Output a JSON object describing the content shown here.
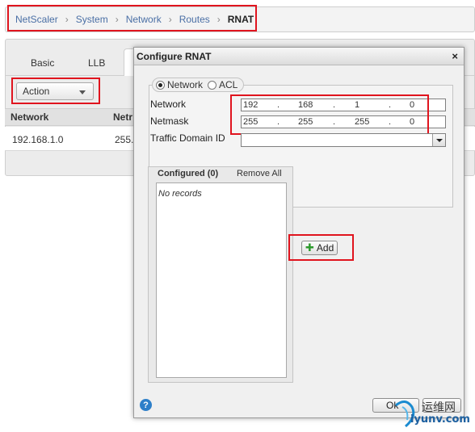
{
  "breadcrumb": [
    "NetScaler",
    "System",
    "Network",
    "Routes",
    "RNAT"
  ],
  "tabs": [
    "Basic",
    "LLB"
  ],
  "action_button": "Action",
  "table": {
    "columns": [
      "Network",
      "Netr"
    ],
    "rows": [
      [
        "192.168.1.0",
        "255.2"
      ]
    ]
  },
  "dialog": {
    "title": "Configure RNAT",
    "close": "×",
    "radio": {
      "network": "Network",
      "acl": "ACL",
      "selected": "network"
    },
    "fields": {
      "network_label": "Network",
      "network_value": [
        "192",
        "168",
        "1",
        "0"
      ],
      "netmask_label": "Netmask",
      "netmask_value": [
        "255",
        "255",
        "255",
        "0"
      ],
      "traffic_domain_label": "Traffic Domain ID",
      "traffic_domain_value": ""
    },
    "configured": {
      "label": "Configured (0)",
      "remove_all": "Remove All",
      "empty": "No records"
    },
    "add_button": "Add",
    "help": "?",
    "ok_button": "Ok"
  },
  "watermark": {
    "cn": "运维网",
    "site": "iyunv.com"
  },
  "colors": {
    "highlight": "#e0141e",
    "link": "#4a6fa5"
  }
}
